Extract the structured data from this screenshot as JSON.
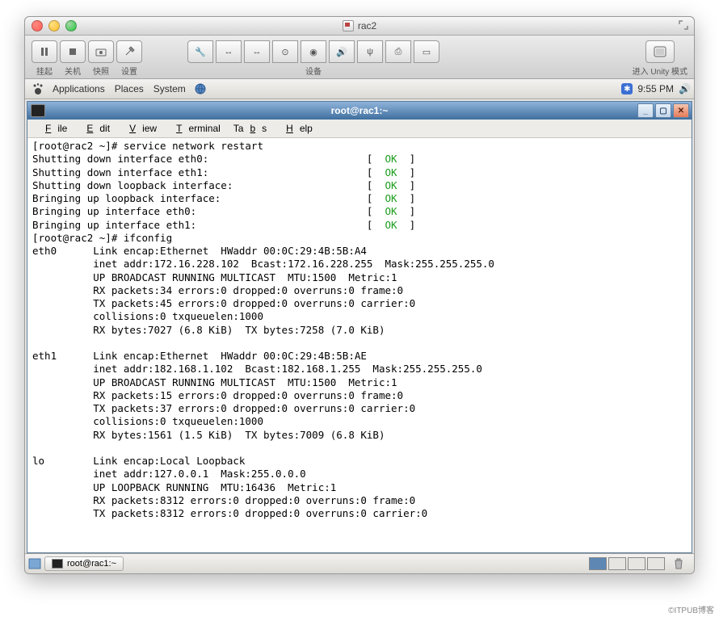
{
  "mac": {
    "title": "rac2",
    "toolbar": {
      "suspend": "挂起",
      "poweroff": "关机",
      "snapshot": "快照",
      "settings": "设置",
      "devices": "设备",
      "unity": "进入 Unity 模式"
    }
  },
  "gnome": {
    "menu": {
      "applications": "Applications",
      "places": "Places",
      "system": "System"
    },
    "clock": "9:55 PM"
  },
  "terminal": {
    "title": "root@rac1:~",
    "menu": {
      "file": "File",
      "edit": "Edit",
      "view": "View",
      "terminal": "Terminal",
      "tabs": "Tabs",
      "help": "Help"
    },
    "prompt1": "[root@rac2 ~]# service network restart",
    "lines_status": [
      {
        "text": "Shutting down interface eth0:",
        "status": "OK"
      },
      {
        "text": "Shutting down interface eth1:",
        "status": "OK"
      },
      {
        "text": "Shutting down loopback interface:",
        "status": "OK"
      },
      {
        "text": "Bringing up loopback interface:",
        "status": "OK"
      },
      {
        "text": "Bringing up interface eth0:",
        "status": "OK"
      },
      {
        "text": "Bringing up interface eth1:",
        "status": "OK"
      }
    ],
    "prompt2": "[root@rac2 ~]# ifconfig",
    "ifconfig": [
      "eth0      Link encap:Ethernet  HWaddr 00:0C:29:4B:5B:A4",
      "          inet addr:172.16.228.102  Bcast:172.16.228.255  Mask:255.255.255.0",
      "          UP BROADCAST RUNNING MULTICAST  MTU:1500  Metric:1",
      "          RX packets:34 errors:0 dropped:0 overruns:0 frame:0",
      "          TX packets:45 errors:0 dropped:0 overruns:0 carrier:0",
      "          collisions:0 txqueuelen:1000",
      "          RX bytes:7027 (6.8 KiB)  TX bytes:7258 (7.0 KiB)",
      "",
      "eth1      Link encap:Ethernet  HWaddr 00:0C:29:4B:5B:AE",
      "          inet addr:182.168.1.102  Bcast:182.168.1.255  Mask:255.255.255.0",
      "          UP BROADCAST RUNNING MULTICAST  MTU:1500  Metric:1",
      "          RX packets:15 errors:0 dropped:0 overruns:0 frame:0",
      "          TX packets:37 errors:0 dropped:0 overruns:0 carrier:0",
      "          collisions:0 txqueuelen:1000",
      "          RX bytes:1561 (1.5 KiB)  TX bytes:7009 (6.8 KiB)",
      "",
      "lo        Link encap:Local Loopback",
      "          inet addr:127.0.0.1  Mask:255.0.0.0",
      "          UP LOOPBACK RUNNING  MTU:16436  Metric:1",
      "          RX packets:8312 errors:0 dropped:0 overruns:0 frame:0",
      "          TX packets:8312 errors:0 dropped:0 overruns:0 carrier:0"
    ]
  },
  "taskbar": {
    "task": "root@rac1:~"
  },
  "watermark": "©ITPUB博客"
}
